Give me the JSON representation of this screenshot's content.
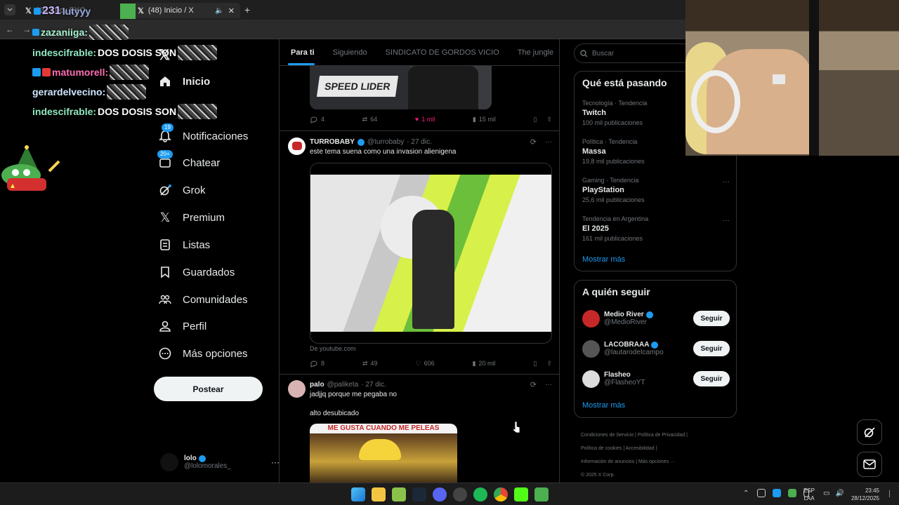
{
  "browser": {
    "tabs": [
      {
        "title": "Inicio / X",
        "label": "(48) Inicio / X"
      },
      {
        "title": "231 Lucy EXO"
      }
    ],
    "new_tab": "+"
  },
  "chat": {
    "lines": [
      {
        "user": "zazaniiga:",
        "text": ""
      },
      {
        "user": "indescifrable:",
        "text": "DOS DOSIS SON"
      },
      {
        "user": "matumorell:",
        "text": ""
      },
      {
        "user": "gerardelvecino:",
        "text": ""
      },
      {
        "user": "indescifrable:",
        "text": "DOS DOSIS SON"
      }
    ],
    "overlay_231": "231",
    "overlay_lucy": "lutyyy"
  },
  "nav": {
    "items": [
      {
        "label": "Inicio",
        "icon": "home-icon"
      },
      {
        "label": "Notificaciones",
        "icon": "bell-icon",
        "badge": "19"
      },
      {
        "label": "Chatear",
        "icon": "mail-icon",
        "badge": "20+"
      },
      {
        "label": "Grok",
        "icon": "grok-icon"
      },
      {
        "label": "Premium",
        "icon": "x-logo-icon"
      },
      {
        "label": "Listas",
        "icon": "list-icon"
      },
      {
        "label": "Guardados",
        "icon": "bookmark-icon"
      },
      {
        "label": "Comunidades",
        "icon": "communities-icon"
      },
      {
        "label": "Perfil",
        "icon": "person-icon"
      },
      {
        "label": "Más opciones",
        "icon": "more-circle-icon"
      }
    ],
    "post_button": "Postear",
    "account": {
      "name": "lolo",
      "handle": "@lolomorales_"
    }
  },
  "feed": {
    "tabs": [
      "Para ti",
      "Siguiendo",
      "SINDICATO DE GORDOS VICIO",
      "The jungle"
    ],
    "post0": {
      "replies": "4",
      "reposts": "64",
      "likes": "1 mil",
      "views": "15 mil",
      "media_text": "SPEED LIDER"
    },
    "post1": {
      "name": "TURROBABY",
      "handle": "@turrobaby",
      "date": "· 27 dic.",
      "text": "este tema suena como una invasion alienigena",
      "source": "De youtube.com",
      "replies": "8",
      "reposts": "49",
      "likes": "606",
      "views": "20 mil"
    },
    "post2": {
      "name": "palo",
      "handle": "@paliketa",
      "date": "· 27 dic.",
      "text1": "jadjjq porque me pegaba no",
      "text2": "alto desubicado",
      "media_caption": "ME GUSTA CUANDO ME PELEAS"
    }
  },
  "right": {
    "search_placeholder": "Buscar",
    "trends_title": "Qué está pasando",
    "trends": [
      {
        "category": "Tecnología · Tendencia",
        "name": "Twitch",
        "count": "100 mil publicaciones"
      },
      {
        "category": "Política · Tendencia",
        "name": "Massa",
        "count": "19,8 mil publicaciones"
      },
      {
        "category": "Gaming · Tendencia",
        "name": "PlayStation",
        "count": "25,6 mil publicaciones"
      },
      {
        "category": "Tendencia en Argentina",
        "name": "El 2025",
        "count": "161 mil publicaciones"
      }
    ],
    "show_more": "Mostrar más",
    "who_title": "A quién seguir",
    "who": [
      {
        "name": "Medio River",
        "handle": "@MedioRiver",
        "button": "Seguir"
      },
      {
        "name": "LACOBRAAA",
        "handle": "@lautarodeIcampo",
        "button": "Seguir"
      },
      {
        "name": "Flasheo",
        "handle": "@FlasheoYT",
        "button": "Seguir"
      }
    ],
    "footer": [
      "Condiciones de Servicio",
      "Política de Privacidad",
      "Política de cookies",
      "Accesibilidad",
      "Información de anuncios",
      "Más opciones ···",
      "© 2025 X Corp."
    ]
  },
  "taskbar": {
    "lang": "ESP",
    "lang2": "LAA",
    "time": "23:45",
    "date": "28/12/2025"
  }
}
